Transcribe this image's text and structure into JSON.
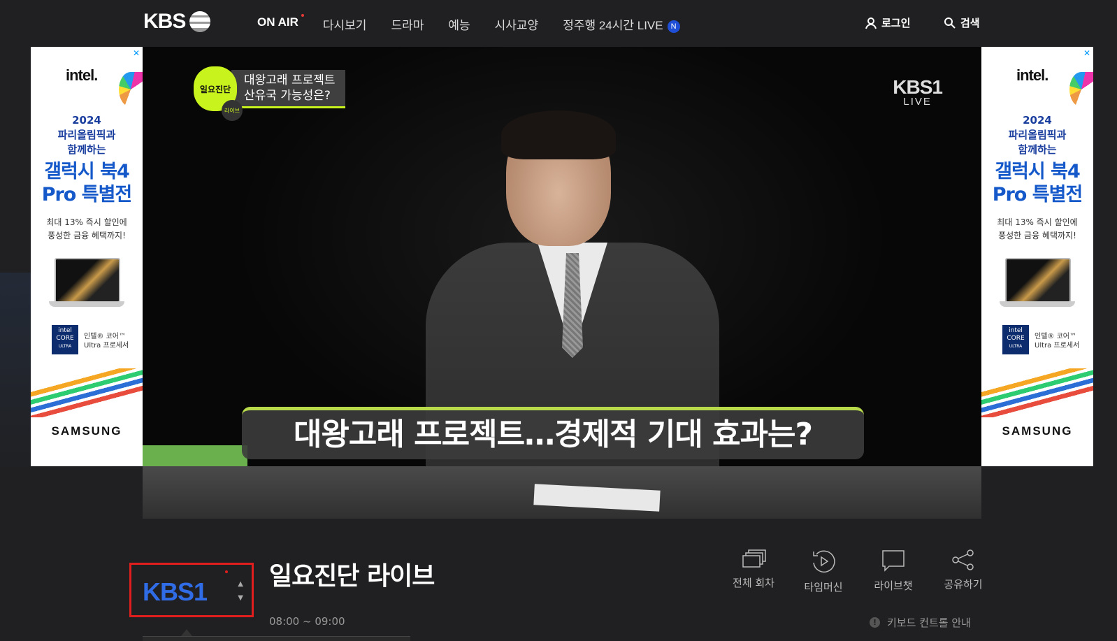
{
  "header": {
    "logo": "KBS",
    "nav": [
      {
        "label": "ON AIR"
      },
      {
        "label": "다시보기"
      },
      {
        "label": "드라마"
      },
      {
        "label": "예능"
      },
      {
        "label": "시사교양"
      },
      {
        "label": "정주행 24시간 LIVE"
      }
    ],
    "nav_badge": "N",
    "login": "로그인",
    "search": "검색"
  },
  "ad": {
    "close": "✕",
    "brand": "intel.",
    "line1": "2024",
    "line2": "파리올림픽과",
    "line3": "함께하는",
    "headline1": "갤럭시 북4",
    "headline2": "Pro 특별전",
    "small1": "최대 13% 즉시 할인에",
    "small2": "풍성한 금융 혜택까지!",
    "core_badge1": "intel",
    "core_badge2": "CORE",
    "core_badge3": "ULTRA",
    "core_text1": "인텔® 코어™",
    "core_text2": "Ultra 프로세서",
    "maker": "SAMSUNG"
  },
  "video": {
    "tag_program": "일요진단",
    "tag_sub": "라이브",
    "tag_line1": "대왕고래 프로젝트",
    "tag_line2": "산유국 가능성은?",
    "channel_mark": "KBS1",
    "channel_live": "LIVE",
    "subtitle": "대왕고래 프로젝트…경제적 기대 효과는?"
  },
  "program": {
    "channel": "KBS1",
    "title": "일요진단 라이브",
    "time": "08:00 ~ 09:00"
  },
  "actions": [
    {
      "label": "전체 회차",
      "icon": "episodes-icon"
    },
    {
      "label": "타임머신",
      "icon": "timemachine-icon"
    },
    {
      "label": "라이브챗",
      "icon": "chat-icon"
    },
    {
      "label": "공유하기",
      "icon": "share-icon"
    }
  ],
  "keyboard_guide": "키보드 컨트롤 안내",
  "colors": {
    "background": "#202022",
    "accent_green": "#c9f31d",
    "kbs_blue": "#2f6ce5",
    "highlight_red": "#e01e1e"
  }
}
